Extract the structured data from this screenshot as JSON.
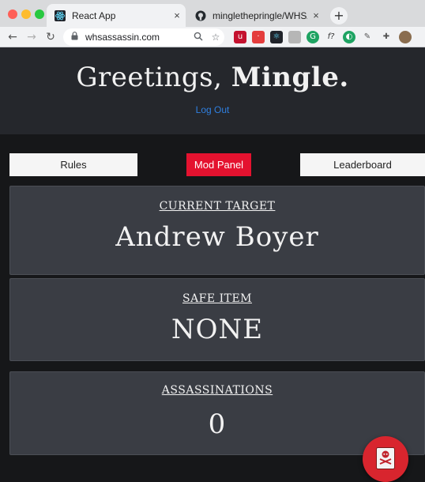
{
  "browser": {
    "tabs": [
      {
        "title": "React App",
        "active": true,
        "favicon": "react-icon"
      },
      {
        "title": "minglethepringle/WHSAssassin",
        "active": false,
        "favicon": "github-icon"
      }
    ],
    "tab_close_glyph": "×",
    "new_tab_glyph": "+",
    "url": "whsassassin.com"
  },
  "header": {
    "greeting_prefix": "Greetings, ",
    "greeting_name": "Mingle.",
    "logout": "Log Out"
  },
  "nav": {
    "rules": "Rules",
    "mod_panel": "Mod Panel",
    "leaderboard": "Leaderboard"
  },
  "cards": {
    "target": {
      "label": "CURRENT TARGET",
      "value": "Andrew Boyer"
    },
    "safe_item": {
      "label": "SAFE ITEM",
      "value": "NONE"
    },
    "assassinations": {
      "label": "ASSASSINATIONS",
      "value": "0"
    }
  },
  "colors": {
    "header_bg": "#25272c",
    "card_bg": "#3a3d44",
    "accent_red": "#e4122f",
    "link_blue": "#2f7fe0"
  },
  "fab_icon": "skull-crossbones-icon"
}
